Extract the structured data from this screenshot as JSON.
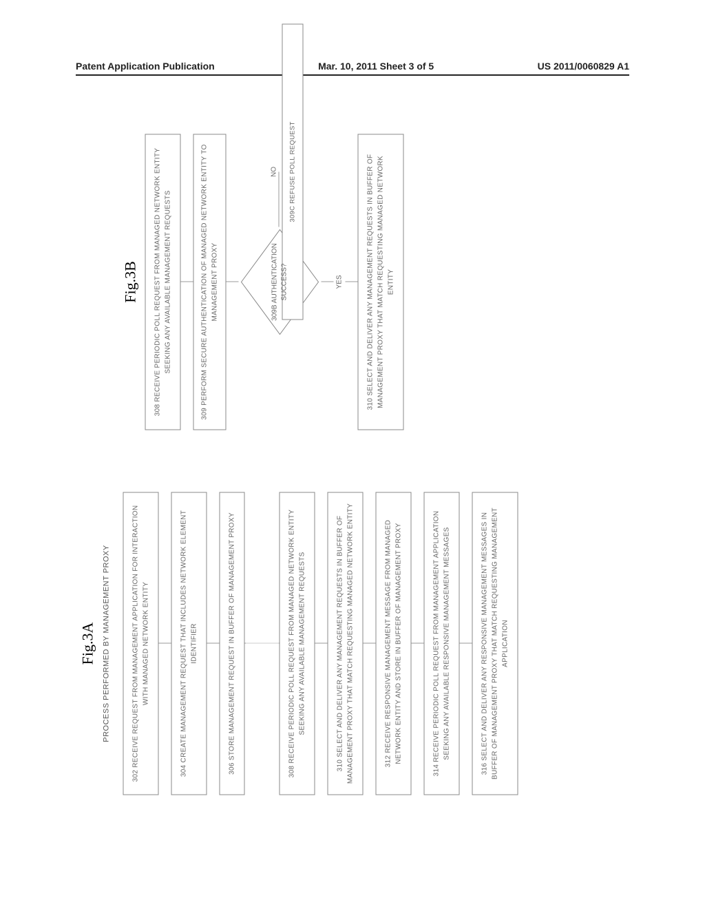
{
  "header": {
    "left": "Patent Application Publication",
    "center": "Mar. 10, 2011  Sheet 3 of 5",
    "right": "US 2011/0060829 A1"
  },
  "figA": {
    "label": "Fig.3A",
    "subtitle": "PROCESS PERFORMED BY MANAGEMENT PROXY",
    "s302": "302 RECEIVE REQUEST FROM MANAGEMENT APPLICATION FOR INTERACTION WITH MANAGED NETWORK ENTITY",
    "s304": "304 CREATE MANAGEMENT REQUEST THAT INCLUDES NETWORK ELEMENT IDENTIFIER",
    "s306": "306 STORE MANAGEMENT REQUEST IN BUFFER OF MANAGEMENT PROXY",
    "s308": "308 RECEIVE PERIODIC POLL REQUEST FROM MANAGED NETWORK ENTITY SEEKING ANY AVAILABLE MANAGEMENT REQUESTS",
    "s310": "310 SELECT AND DELIVER ANY MANAGEMENT REQUESTS IN BUFFER OF MANAGEMENT PROXY THAT MATCH REQUESTING MANAGED NETWORK ENTITY",
    "s312": "312 RECEIVE RESPONSIVE MANAGEMENT MESSAGE FROM MANAGED NETWORK ENTITY AND STORE IN BUFFER OF MANAGEMENT PROXY",
    "s314": "314 RECEIVE PERIODIC POLL REQUEST FROM MANAGEMENT APPLICATION SEEKING ANY AVAILABLE RESPONSIVE MANAGEMENT MESSAGES",
    "s316": "316 SELECT AND DELIVER ANY RESPONSIVE MANAGEMENT MESSAGES IN BUFFER OF MANAGEMENT PROXY THAT MATCH REQUESTING MANAGEMENT APPLICATION"
  },
  "figB": {
    "label": "Fig.3B",
    "s308": "308 RECEIVE PERIODIC POLL REQUEST FROM MANAGED NETWORK ENTITY SEEKING ANY AVAILABLE MANAGEMENT REQUESTS",
    "s309": "309 PERFORM SECURE AUTHENTICATION OF MANAGED NETWORK ENTITY TO MANAGEMENT PROXY",
    "decision": "309B AUTHENTICATION SUCCESS?",
    "yes": "YES",
    "no": "NO",
    "s309c": "309C REFUSE POLL REQUEST",
    "s310": "310 SELECT AND DELIVER ANY MANAGEMENT REQUESTS IN BUFFER OF MANAGEMENT PROXY THAT MATCH REQUESTING MANAGED NETWORK ENTITY"
  }
}
